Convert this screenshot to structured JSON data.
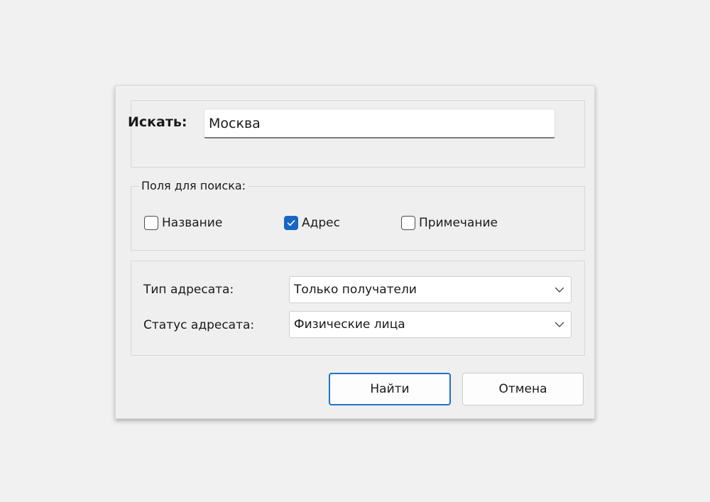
{
  "search": {
    "label": "Искать:",
    "value": "Москва"
  },
  "fields": {
    "legend": "Поля для поиска:",
    "checkboxes": [
      {
        "label": "Название",
        "checked": false
      },
      {
        "label": "Адрес",
        "checked": true
      },
      {
        "label": "Примечание",
        "checked": false
      }
    ]
  },
  "recipient": {
    "type_label": "Тип адресата:",
    "type_value": "Только получатели",
    "status_label": "Статус адресата:",
    "status_value": "Физические лица"
  },
  "buttons": {
    "find": "Найти",
    "cancel": "Отмена"
  },
  "colors": {
    "accent": "#1866c4",
    "default_button_border": "#1d73c9"
  }
}
